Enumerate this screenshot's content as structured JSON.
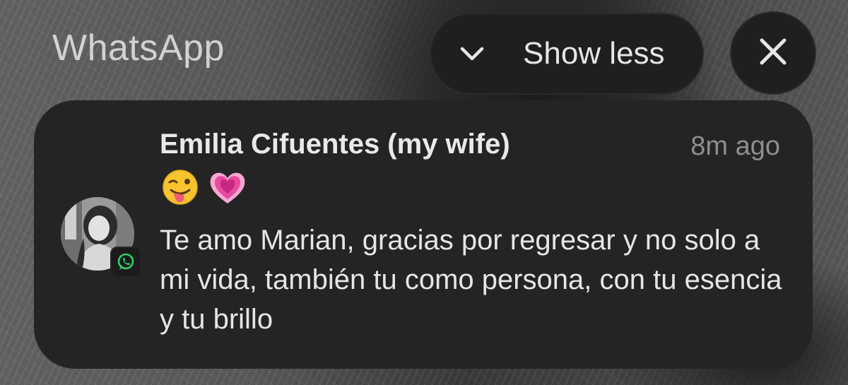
{
  "header": {
    "app_name": "WhatsApp",
    "show_less_label": "Show less",
    "show_less_icon": "chevron-down-icon",
    "close_icon": "close-icon"
  },
  "notification": {
    "sender": "Emilia Cifuentes (my wife)",
    "time": "8m ago",
    "emojis": [
      "winking-face-with-tongue-emoji",
      "growing-heart-emoji"
    ],
    "message": "Te amo Marian, gracias por regresar y no solo a mi vida, también tu como persona, con tu esencia y tu brillo",
    "avatar": "contact-photo",
    "app_badge_icon": "whatsapp-icon"
  },
  "colors": {
    "card_background": "#242425",
    "button_background": "#1f1f20",
    "whatsapp_green": "#25D366",
    "heart_pink": "#e94aa0"
  }
}
